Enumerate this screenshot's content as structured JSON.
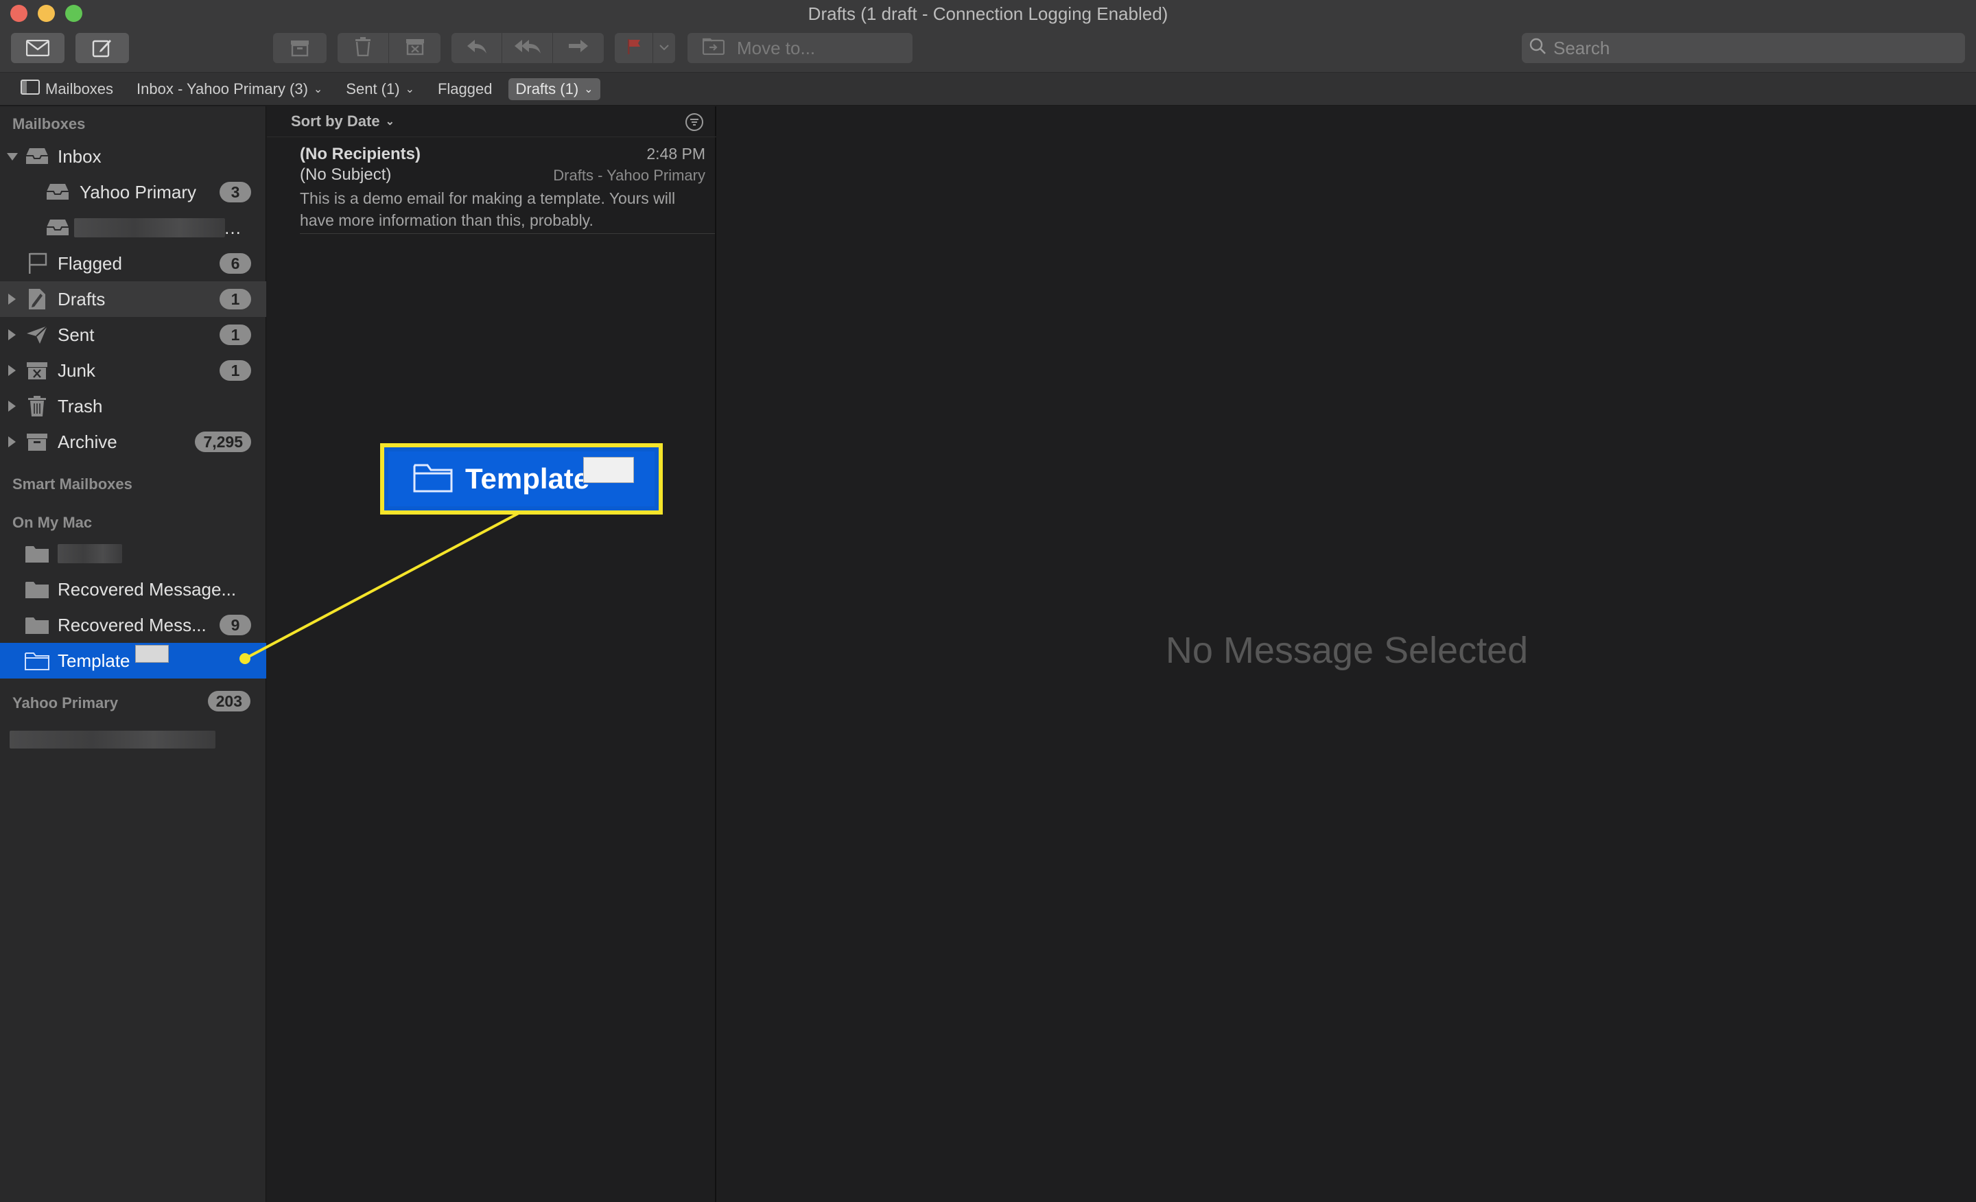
{
  "window": {
    "title": "Drafts (1 draft - Connection Logging Enabled)"
  },
  "toolbar": {
    "get_mail_icon": "envelope-icon",
    "compose_icon": "compose-icon",
    "archive_icon": "archive-icon",
    "delete_icon": "trash-icon",
    "junk_icon": "junk-icon",
    "reply_icon": "reply-icon",
    "reply_all_icon": "reply-all-icon",
    "forward_icon": "forward-icon",
    "flag_icon": "flag-icon",
    "move_to_placeholder": "Move to...",
    "search_placeholder": "Search",
    "colors": {
      "flag": "#a33b36"
    }
  },
  "favorites_bar": {
    "mailboxes_label": "Mailboxes",
    "items": [
      {
        "label": "Inbox - Yahoo Primary (3)",
        "has_menu": true,
        "active": false
      },
      {
        "label": "Sent (1)",
        "has_menu": true,
        "active": false
      },
      {
        "label": "Flagged",
        "has_menu": false,
        "active": false
      },
      {
        "label": "Drafts (1)",
        "has_menu": true,
        "active": true
      }
    ]
  },
  "sidebar": {
    "sections": {
      "mailboxes": "Mailboxes",
      "smart_mailboxes": "Smart Mailboxes",
      "on_my_mac": "On My Mac",
      "yahoo_primary": "Yahoo Primary"
    },
    "yahoo_primary_count": "203",
    "mailboxes": [
      {
        "label": "Inbox",
        "count": ""
      },
      {
        "label": "Yahoo Primary",
        "count": "3"
      },
      {
        "label": "…",
        "count": ""
      },
      {
        "label": "Flagged",
        "count": "6"
      },
      {
        "label": "Drafts",
        "count": "1"
      },
      {
        "label": "Sent",
        "count": "1"
      },
      {
        "label": "Junk",
        "count": "1"
      },
      {
        "label": "Trash",
        "count": ""
      },
      {
        "label": "Archive",
        "count": "7,295"
      }
    ],
    "on_my_mac": [
      {
        "label": "",
        "count": ""
      },
      {
        "label": "Recovered Message...",
        "count": ""
      },
      {
        "label": "Recovered Mess...",
        "count": "9"
      },
      {
        "label": "Template",
        "count": ""
      }
    ],
    "colors": {
      "selection": "#0a5cd0"
    }
  },
  "message_list": {
    "sort_label": "Sort by Date",
    "messages": [
      {
        "from": "(No Recipients)",
        "time": "2:48 PM",
        "subject": "(No Subject)",
        "mailbox": "Drafts - Yahoo Primary",
        "preview": "This is a demo email for making a template. Yours will have more information than this, probably."
      }
    ]
  },
  "viewer": {
    "empty_text": "No Message Selected"
  },
  "annotation": {
    "callout_label": "Template",
    "colors": {
      "highlight": "#f5e52a",
      "fill": "#0a60db"
    }
  }
}
